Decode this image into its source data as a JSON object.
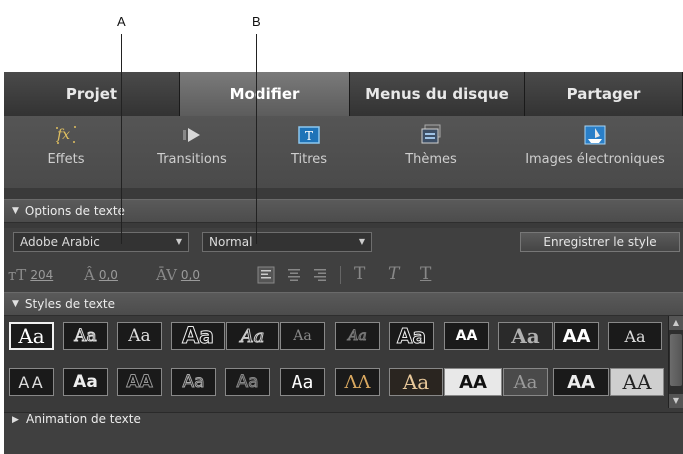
{
  "callouts": [
    {
      "id": "A",
      "label": "A"
    },
    {
      "id": "B",
      "label": "B"
    }
  ],
  "tabs": [
    {
      "label": "Projet",
      "active": false
    },
    {
      "label": "Modifier",
      "active": true
    },
    {
      "label": "Menus du disque",
      "active": false
    },
    {
      "label": "Partager",
      "active": false
    }
  ],
  "toolbar": [
    {
      "label": "Effets",
      "icon": "fx-icon"
    },
    {
      "label": "Transitions",
      "icon": "transition-arrow-icon"
    },
    {
      "label": "Titres",
      "icon": "title-frame-icon"
    },
    {
      "label": "Thèmes",
      "icon": "themes-stack-icon"
    },
    {
      "label": "Images électroniques",
      "icon": "disc-images-icon"
    }
  ],
  "text_options": {
    "title": "Options de texte",
    "font_family": "Adobe Arabic",
    "font_style": "Normal",
    "save_style_label": "Enregistrer le style"
  },
  "formatting": {
    "font_size": "204",
    "leading": "0,0",
    "kerning": "0,0",
    "align_icons": [
      "align-left-icon",
      "align-center-icon",
      "align-right-icon"
    ],
    "style_icons": [
      "regular-type-icon",
      "italic-type-icon",
      "underline-type-icon"
    ]
  },
  "text_styles": {
    "title": "Styles de texte",
    "swatch_text": [
      "Aa",
      "Aa",
      "Aa",
      "Aa",
      "Aa",
      "Aa",
      "Aa",
      "Aa",
      "AA",
      "Aa",
      "AA",
      "Aa",
      "AA",
      "Aa",
      "AA",
      "Aa",
      "Aa",
      "Aa",
      "ΛΛ",
      "Aa",
      "AA",
      "Aa",
      "AA",
      "AA"
    ],
    "selected_index": 0
  },
  "next_section": {
    "title": "Animation de texte"
  }
}
